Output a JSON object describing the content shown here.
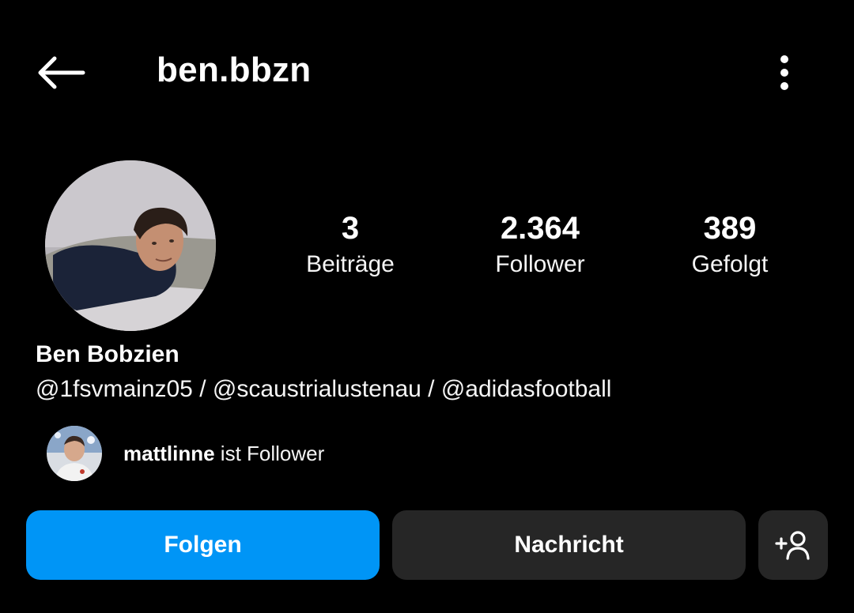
{
  "header": {
    "username": "ben.bbzn",
    "back_icon": "arrow-left-icon",
    "more_icon": "vertical-dots-icon"
  },
  "profile": {
    "full_name": "Ben Bobzien",
    "bio_links": [
      "@1fsvmainz05",
      "@scaustrialustenau",
      "@adidasfootball"
    ],
    "bio_separator": " / "
  },
  "stats": [
    {
      "value": "3",
      "label": "Beiträge"
    },
    {
      "value": "2.364",
      "label": "Follower"
    },
    {
      "value": "389",
      "label": "Gefolgt"
    }
  ],
  "mutual": {
    "username": "mattlinne",
    "suffix": " ist Follower"
  },
  "actions": {
    "follow_label": "Folgen",
    "message_label": "Nachricht",
    "suggest_icon": "add-person-icon"
  },
  "colors": {
    "background": "#000000",
    "follow_button": "#0095f6",
    "secondary_button": "#262626",
    "text": "#ffffff"
  }
}
